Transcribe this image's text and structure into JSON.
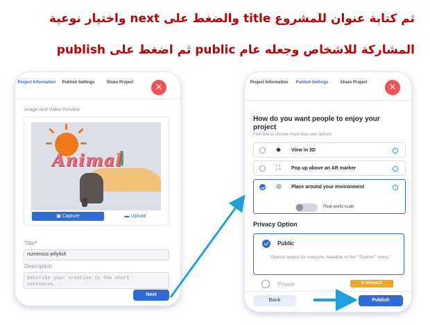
{
  "instructions": {
    "line1": "ثم كتابة عنوان للمشروع title والضغط على next واختيار نوعية",
    "line2": "المشاركة للاشخاص وجعله عام public ثم اضغط على publish"
  },
  "colors": {
    "accent": "#2f6bd6",
    "close": "#ee5353",
    "instruction_text": "#c00000",
    "arrow": "#1aa3e0",
    "upgrade": "#f5a623"
  },
  "left_screen": {
    "tabs": [
      "Project Information",
      "Publish Settings",
      "Share Project"
    ],
    "active_tab": "Project Information",
    "preview_label": "Image And Video Preview",
    "preview_text": "Animal",
    "capture_label": "Capture",
    "upload_label": "Upload",
    "title_label": "Title",
    "title_required_mark": "*",
    "title_value": "numerous-jellyfish",
    "description_label": "Description",
    "description_placeholder": "Describe your creation in few short sentences...",
    "next_label": "Next"
  },
  "right_screen": {
    "tabs": [
      "Project Information",
      "Publish Settings",
      "Share Project"
    ],
    "active_tab": "Publish Settings",
    "question": "How do you want people to enjoy your project",
    "question_note": "Feel free to choose more than one options",
    "options": [
      {
        "label": "View in 3D",
        "selected": false,
        "icon": "cube-icon"
      },
      {
        "label": "Pop up above an AR marker",
        "selected": false,
        "icon": "scan-frame-icon"
      },
      {
        "label": "Place around your environment",
        "selected": true,
        "icon": "target-icon"
      }
    ],
    "real_world_scale_label": "Real-world scale",
    "real_world_scale_on": false,
    "privacy_title": "Privacy Option",
    "public_label": "Public",
    "public_description": "\"Open to access for everyone. Available on the \"\"Explore\"\" menu.\"",
    "private_label": "Private",
    "upgrade_label": "UPGRADE",
    "back_label": "Back",
    "publish_label": "Publish"
  }
}
